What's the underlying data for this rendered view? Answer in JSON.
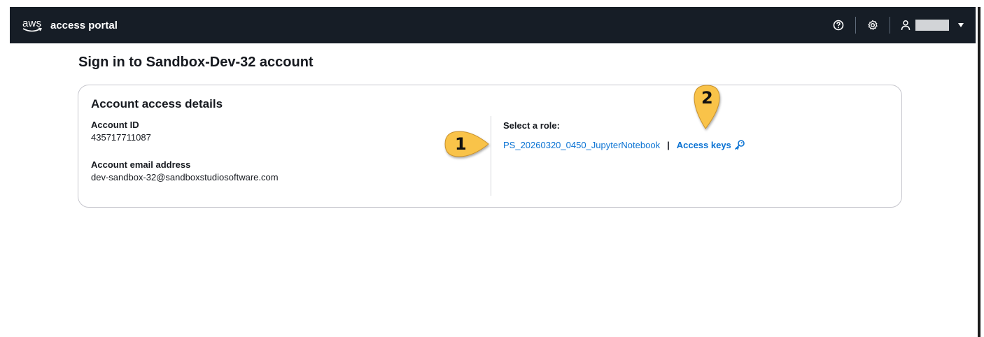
{
  "header": {
    "brand_logo": "aws",
    "portal_name": "access portal",
    "icons": {
      "help": "help-circle-icon",
      "settings": "gear-icon",
      "user": "user-icon",
      "dropdown": "caret-down-icon"
    },
    "bar_color": "#161d26"
  },
  "page": {
    "title": "Sign in to Sandbox-Dev-32 account"
  },
  "card": {
    "title": "Account access details",
    "account_id_label": "Account ID",
    "account_id_value": "435717711087",
    "email_label": "Account email address",
    "email_value": "dev-sandbox-32@sandboxstudiosoftware.com",
    "role_label": "Select a role:",
    "role_name": "PS_20260320_0450_JupyterNotebook",
    "separator": "|",
    "access_keys_label": "Access keys",
    "access_keys_icon": "key-icon",
    "link_color": "#0972d3"
  },
  "callouts": [
    {
      "number": "1"
    },
    {
      "number": "2"
    }
  ],
  "callout_color": "#f9c34a"
}
